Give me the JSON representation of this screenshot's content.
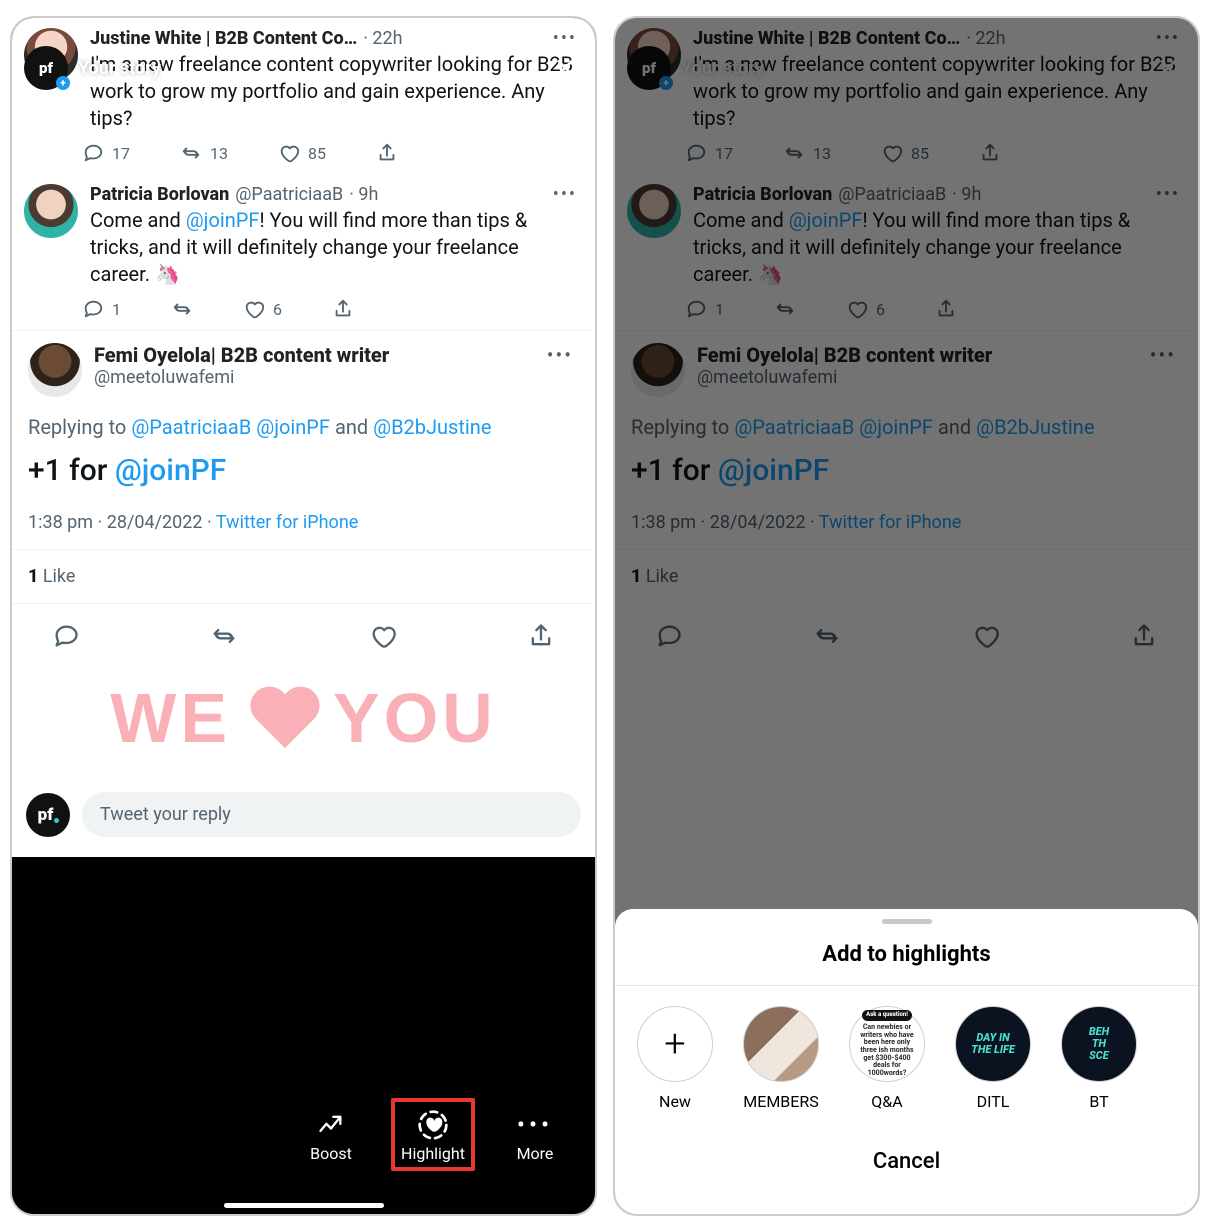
{
  "story": {
    "username": "Your story",
    "close_glyph": "✕",
    "avatar_text": "pf"
  },
  "tweets": [
    {
      "name": "Justine White | B2B Content Co…",
      "handle": "",
      "age": "· 22h",
      "text": "I'm a new freelance content copywriter looking for B2B work to grow my portfolio and gain experience. Any tips?",
      "replies": "17",
      "retweets": "13",
      "likes": "85"
    },
    {
      "name": "Patricia Borlovan",
      "handle": "@PaatriciaaB",
      "age": "· 9h",
      "text_pre": "Come and ",
      "mention": "@joinPF",
      "text_post": "! You will find more than tips & tricks, and it will definitely change your freelance career. 🦄",
      "replies": "1",
      "retweets": "",
      "likes": "6"
    }
  ],
  "main_tweet": {
    "name": "Femi Oyelola| B2B content writer",
    "handle": "@meetoluwafemi",
    "reply_prefix": "Replying to ",
    "reply_m1": "@PaatriciaaB",
    "reply_m2": "@joinPF",
    "reply_and": " and ",
    "reply_m3": "@B2bJustine",
    "text_pre": "+1 for ",
    "mention": "@joinPF",
    "time": "1:38 pm",
    "date": "28/04/2022",
    "source": "Twitter for iPhone",
    "likes_n": "1",
    "likes_label": " Like"
  },
  "sticker": {
    "we": "WE",
    "you": "YOU"
  },
  "reply_input": {
    "placeholder": "Tweet your reply",
    "avatar": "pf"
  },
  "story_controls": {
    "boost": "Boost",
    "highlight": "Highlight",
    "more": "More"
  },
  "sheet": {
    "title": "Add to highlights",
    "new_plus": "+",
    "items": [
      {
        "label": "New"
      },
      {
        "label": "MEMBERS"
      },
      {
        "label": "Q&A"
      },
      {
        "label": "DITL",
        "cover": "DAY IN\nTHE LIFE"
      },
      {
        "label": "BT",
        "cover": "BEH\nTH\nSCE"
      }
    ],
    "cancel": "Cancel",
    "qa_head": "Ask a question!"
  }
}
